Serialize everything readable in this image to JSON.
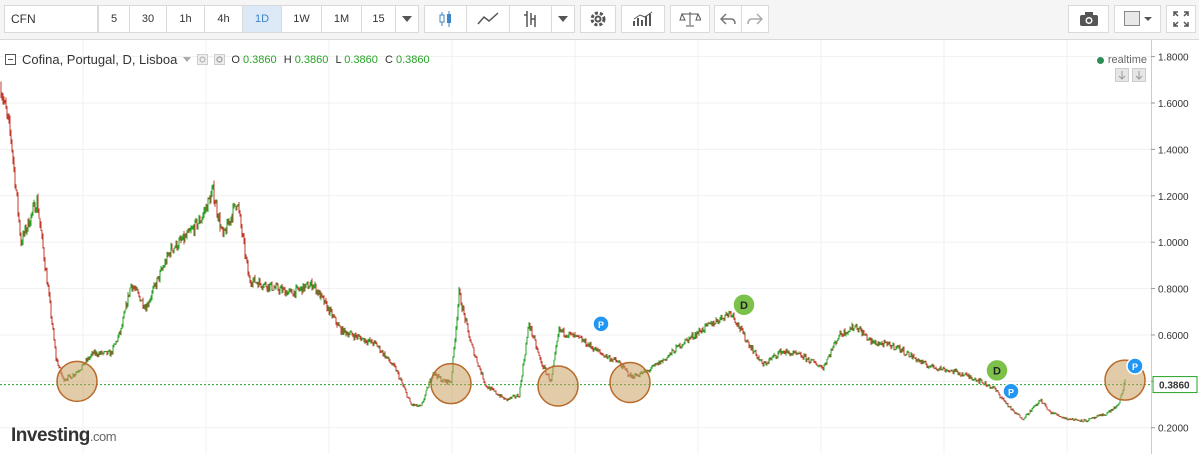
{
  "toolbar": {
    "symbol": "CFN",
    "intervals": [
      "5",
      "30",
      "1h",
      "4h",
      "1D",
      "1W",
      "1M",
      "15"
    ],
    "active_interval": "1D",
    "icons": [
      "chevron-down-icon",
      "candles-icon",
      "line-chart-icon",
      "bar-style-icon",
      "chevron-down-icon",
      "gear-icon",
      "indicators-icon",
      "compare-icon",
      "undo-icon",
      "redo-icon",
      "camera-icon",
      "template-icon",
      "chevron-down-icon",
      "fullscreen-icon"
    ]
  },
  "legend": {
    "title": "Cofina, Portugal, D, Lisboa",
    "o_label": "O",
    "o_value": "0.3860",
    "h_label": "H",
    "h_value": "0.3860",
    "l_label": "L",
    "l_value": "0.3860",
    "c_label": "C",
    "c_value": "0.3860",
    "realtime": "realtime"
  },
  "brand": {
    "name": "Investing",
    "suffix": ".com"
  },
  "colors": {
    "up": "#27a327",
    "down": "#c0392b",
    "price_line": "#27a327",
    "highlight_circle": "#c8a060",
    "marker_p": "#2196f3",
    "marker_d": "#7cc24a"
  },
  "chart_data": {
    "type": "candlestick",
    "title": "",
    "ylim": [
      0.16,
      1.82
    ],
    "y_ticks": [
      "1.8000",
      "1.6000",
      "1.4000",
      "1.2000",
      "1.0000",
      "0.8000",
      "0.6000",
      "0.4000",
      "0.2000"
    ],
    "y_tick_values": [
      1.8,
      1.6,
      1.4,
      1.2,
      1.0,
      0.8,
      0.6,
      0.4,
      0.2
    ],
    "current_price": 0.386,
    "current_price_label": "0.3860",
    "bar_count": 1125,
    "price_path": [
      [
        0,
        1.67
      ],
      [
        10,
        1.45
      ],
      [
        20,
        1.0
      ],
      [
        36,
        1.18
      ],
      [
        47,
        0.8
      ],
      [
        55,
        0.5
      ],
      [
        62,
        0.41
      ],
      [
        70,
        0.42
      ],
      [
        80,
        0.46
      ],
      [
        92,
        0.52
      ],
      [
        110,
        0.52
      ],
      [
        120,
        0.62
      ],
      [
        130,
        0.82
      ],
      [
        145,
        0.72
      ],
      [
        155,
        0.82
      ],
      [
        170,
        0.97
      ],
      [
        185,
        1.02
      ],
      [
        200,
        1.1
      ],
      [
        212,
        1.22
      ],
      [
        222,
        1.02
      ],
      [
        236,
        1.18
      ],
      [
        248,
        0.84
      ],
      [
        262,
        0.82
      ],
      [
        290,
        0.78
      ],
      [
        312,
        0.82
      ],
      [
        340,
        0.62
      ],
      [
        375,
        0.56
      ],
      [
        395,
        0.45
      ],
      [
        410,
        0.3
      ],
      [
        420,
        0.29
      ],
      [
        432,
        0.44
      ],
      [
        442,
        0.4
      ],
      [
        450,
        0.4
      ],
      [
        458,
        0.78
      ],
      [
        470,
        0.56
      ],
      [
        485,
        0.38
      ],
      [
        505,
        0.32
      ],
      [
        518,
        0.34
      ],
      [
        528,
        0.65
      ],
      [
        540,
        0.48
      ],
      [
        550,
        0.4
      ],
      [
        558,
        0.62
      ],
      [
        580,
        0.58
      ],
      [
        600,
        0.52
      ],
      [
        618,
        0.48
      ],
      [
        630,
        0.42
      ],
      [
        645,
        0.44
      ],
      [
        665,
        0.5
      ],
      [
        680,
        0.56
      ],
      [
        700,
        0.62
      ],
      [
        730,
        0.7
      ],
      [
        745,
        0.58
      ],
      [
        762,
        0.47
      ],
      [
        780,
        0.53
      ],
      [
        800,
        0.51
      ],
      [
        822,
        0.46
      ],
      [
        838,
        0.6
      ],
      [
        855,
        0.64
      ],
      [
        870,
        0.57
      ],
      [
        895,
        0.55
      ],
      [
        925,
        0.47
      ],
      [
        955,
        0.44
      ],
      [
        975,
        0.41
      ],
      [
        993,
        0.37
      ],
      [
        1012,
        0.27
      ],
      [
        1022,
        0.24
      ],
      [
        1040,
        0.32
      ],
      [
        1048,
        0.27
      ],
      [
        1065,
        0.24
      ],
      [
        1085,
        0.23
      ],
      [
        1105,
        0.26
      ],
      [
        1118,
        0.3
      ],
      [
        1125,
        0.42
      ],
      [
        1134,
        0.39
      ]
    ],
    "highlight_circles": [
      {
        "bar": 76,
        "price": 0.4
      },
      {
        "bar": 450,
        "price": 0.39
      },
      {
        "bar": 557,
        "price": 0.38
      },
      {
        "bar": 629,
        "price": 0.395
      },
      {
        "bar": 1124,
        "price": 0.405
      }
    ],
    "markers": [
      {
        "label": "P",
        "bar": 600,
        "price": 0.648,
        "kind": "p"
      },
      {
        "label": "D",
        "bar": 743,
        "price": 0.73,
        "kind": "d"
      },
      {
        "label": "D",
        "bar": 996,
        "price": 0.447,
        "kind": "d"
      },
      {
        "label": "P",
        "bar": 1010,
        "price": 0.357,
        "kind": "p"
      },
      {
        "label": "P",
        "bar": 1134,
        "price": 0.466,
        "kind": "p"
      }
    ]
  }
}
